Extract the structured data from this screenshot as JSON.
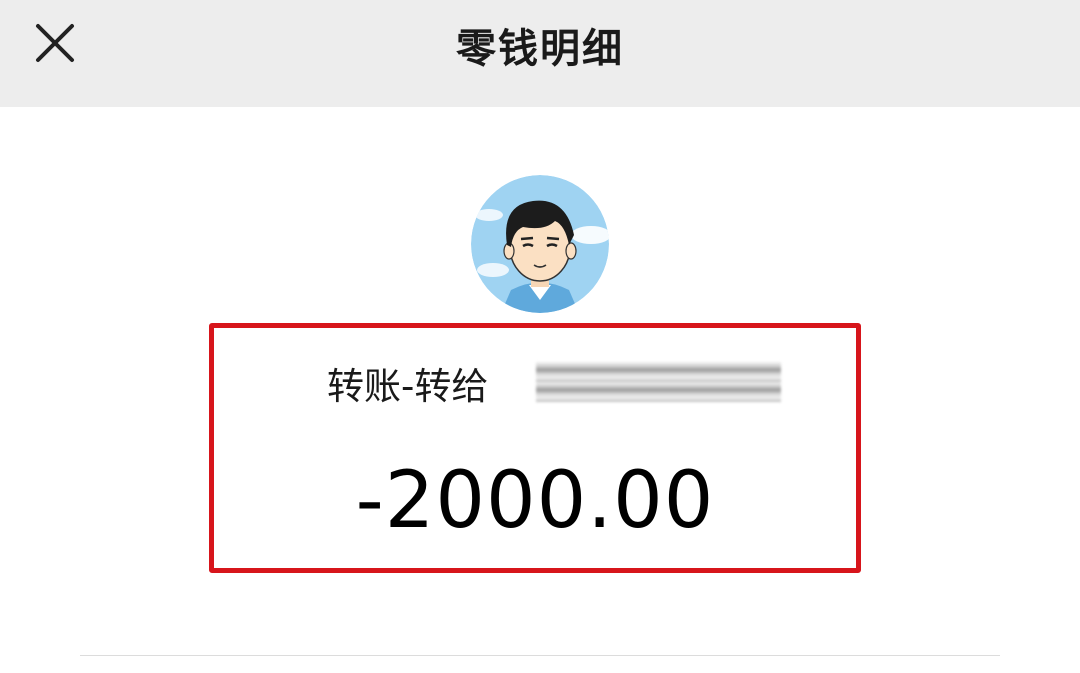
{
  "header": {
    "title": "零钱明细",
    "close_icon": "close-icon"
  },
  "transaction": {
    "description_prefix": "转账-转给",
    "description_redacted": true,
    "amount": "-2000.00",
    "highlight_color": "#d7151b"
  },
  "colors": {
    "header_bg": "#ededed",
    "page_bg": "#ffffff"
  }
}
